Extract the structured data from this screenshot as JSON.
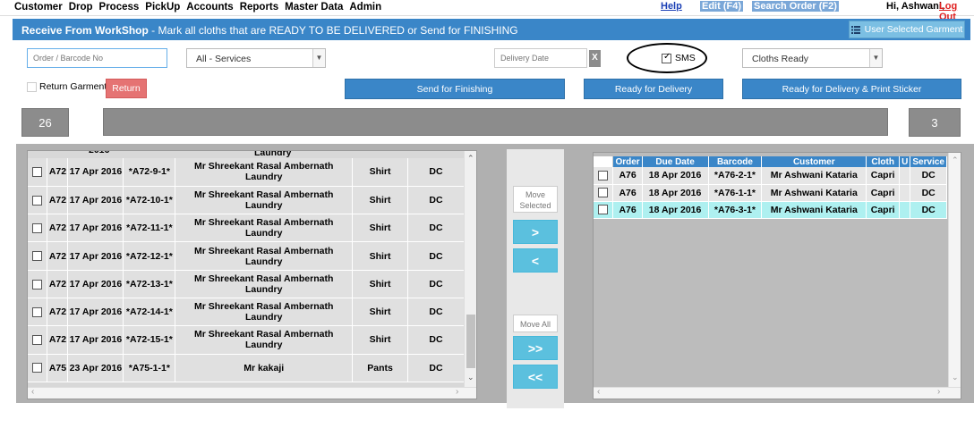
{
  "topnav": {
    "menu": [
      "Customer",
      "Drop",
      "Process",
      "PickUp",
      "Accounts",
      "Reports",
      "Master Data",
      "Admin"
    ],
    "help": "Help",
    "edit": "Edit (F4)",
    "search_order": "Search Order (F2)",
    "greeting": "Hi, Ashwani,",
    "logout": "Log Out"
  },
  "header": {
    "title": "Receive From WorkShop",
    "subtitle": " - Mark all cloths that are READY TO BE DELIVERED or Send for FINISHING",
    "user_selected_button": "User Selected Garment"
  },
  "filters": {
    "barcode_placeholder": "Order / Barcode No",
    "services_value": "All - Services",
    "delivery_date_placeholder": "Delivery Date",
    "clear_label": "X",
    "sms_label": "SMS",
    "status_value": "Cloths Ready"
  },
  "actions": {
    "return_garment_label": "Return Garment",
    "return_button": "Return",
    "send_finishing": "Send for Finishing",
    "ready_delivery": "Ready for Delivery",
    "ready_print": "Ready for Delivery & Print Sticker"
  },
  "counts": {
    "left": "26",
    "right": "3"
  },
  "left_table": {
    "partial_top": "Laundry",
    "rows": [
      {
        "order": "A72",
        "date": "17 Apr 2016",
        "barcode": "*A72-9-1*",
        "customer": "Mr Shreekant Rasal Ambernath Laundry",
        "cloth": "Shirt",
        "service": "DC"
      },
      {
        "order": "A72",
        "date": "17 Apr 2016",
        "barcode": "*A72-10-1*",
        "customer": "Mr Shreekant Rasal Ambernath Laundry",
        "cloth": "Shirt",
        "service": "DC"
      },
      {
        "order": "A72",
        "date": "17 Apr 2016",
        "barcode": "*A72-11-1*",
        "customer": "Mr Shreekant Rasal Ambernath Laundry",
        "cloth": "Shirt",
        "service": "DC"
      },
      {
        "order": "A72",
        "date": "17 Apr 2016",
        "barcode": "*A72-12-1*",
        "customer": "Mr Shreekant Rasal Ambernath Laundry",
        "cloth": "Shirt",
        "service": "DC"
      },
      {
        "order": "A72",
        "date": "17 Apr 2016",
        "barcode": "*A72-13-1*",
        "customer": "Mr Shreekant Rasal Ambernath Laundry",
        "cloth": "Shirt",
        "service": "DC"
      },
      {
        "order": "A72",
        "date": "17 Apr 2016",
        "barcode": "*A72-14-1*",
        "customer": "Mr Shreekant Rasal Ambernath Laundry",
        "cloth": "Shirt",
        "service": "DC"
      },
      {
        "order": "A72",
        "date": "17 Apr 2016",
        "barcode": "*A72-15-1*",
        "customer": "Mr Shreekant Rasal Ambernath Laundry",
        "cloth": "Shirt",
        "service": "DC"
      },
      {
        "order": "A75",
        "date": "23 Apr 2016",
        "barcode": "*A75-1-1*",
        "customer": "Mr kakaji",
        "cloth": "Pants",
        "service": "DC"
      }
    ]
  },
  "middle": {
    "move_selected": "Move Selected",
    "move_right": ">",
    "move_left": "<",
    "move_all": "Move All",
    "move_all_right": ">>",
    "move_all_left": "<<"
  },
  "right_table": {
    "headers": [
      "Order",
      "Due Date",
      "Barcode",
      "Customer",
      "Cloth",
      "U",
      "Service"
    ],
    "rows": [
      {
        "order": "A76",
        "date": "18 Apr 2016",
        "barcode": "*A76-2-1*",
        "customer": "Mr Ashwani Kataria",
        "cloth": "Capri",
        "u": "",
        "service": "DC",
        "selected": false
      },
      {
        "order": "A76",
        "date": "18 Apr 2016",
        "barcode": "*A76-1-1*",
        "customer": "Mr Ashwani Kataria",
        "cloth": "Capri",
        "u": "",
        "service": "DC",
        "selected": false
      },
      {
        "order": "A76",
        "date": "18 Apr 2016",
        "barcode": "*A76-3-1*",
        "customer": "Mr Ashwani Kataria",
        "cloth": "Capri",
        "u": "",
        "service": "DC",
        "selected": true
      }
    ]
  },
  "colors": {
    "accent": "#3a86c8",
    "selected_row": "#aef0f0",
    "logout": "#e02020",
    "return": "#e57373"
  }
}
